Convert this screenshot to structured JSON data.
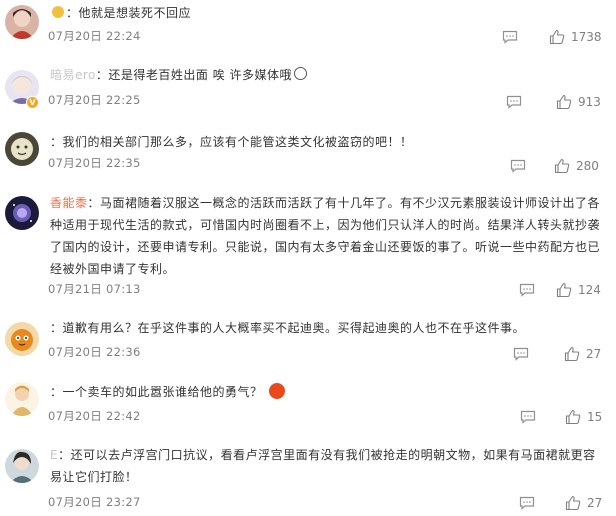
{
  "comments": [
    {
      "username": "",
      "text": "他就是想装死不回应",
      "time": "07月20日 22:24",
      "likes": "1738"
    },
    {
      "username": "暗易ero",
      "text": "还是得老百姓出面 唉 许多媒体哦",
      "time": "07月20日 22:25",
      "likes": "913"
    },
    {
      "username": "",
      "text": "我们的相关部门那么多，应该有个能管这类文化被盗窃的吧！！",
      "time": "07月20日 22:35",
      "likes": "280"
    },
    {
      "username": "香能黍",
      "text": "马面裙随着汉服这一概念的活跃而活跃了有十几年了。有不少汉元素服装设计师设计出了各种适用于现代生活的款式，可惜国内时尚圈看不上，因为他们只认洋人的时尚。结果洋人转头就抄袭了国内的设计，还要申请专利。只能说，国内有太多守着金山还要饭的事了。听说一些中药配方也已经被外国申请了专利。",
      "time": "07月21日 07:13",
      "likes": "124"
    },
    {
      "username": "",
      "text": "道歉有用么？在乎这件事的人大概率买不起迪奥。买得起迪奥的人也不在乎这件事。",
      "time": "07月20日 22:36",
      "likes": "27"
    },
    {
      "username": "",
      "text": "一个卖车的如此嚣张谁给他的勇气？",
      "time": "07月20日 22:42",
      "likes": "15"
    },
    {
      "username": "E",
      "text": "还可以去卢浮宫门口抗议，看看卢浮宫里面有没有我们被抢走的明朝文物，如果有马面裙就更容易让它们打脸！",
      "time": "07月20日 23:27",
      "likes": "27"
    }
  ]
}
